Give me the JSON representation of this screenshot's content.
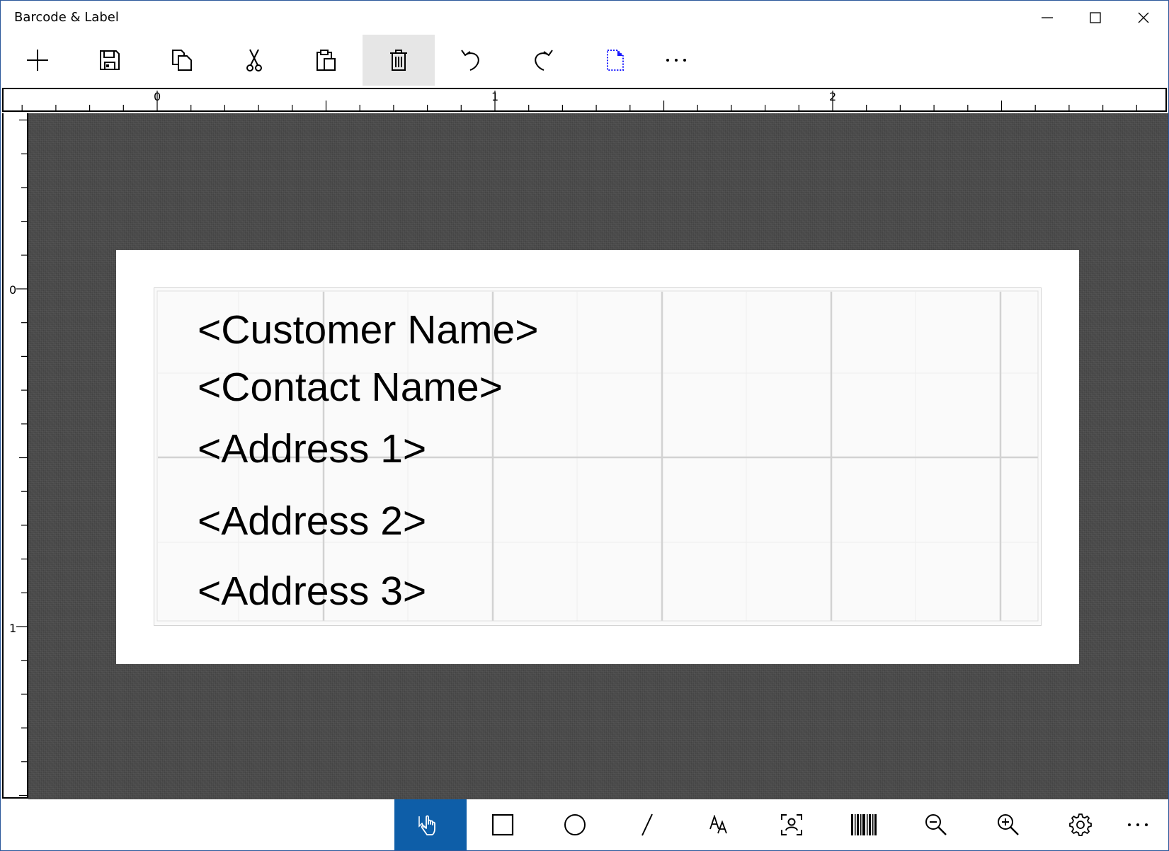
{
  "window": {
    "title": "Barcode & Label",
    "controls": [
      "minimize-icon",
      "maximize-icon",
      "close-icon"
    ]
  },
  "toolbar": {
    "items": [
      {
        "name": "new",
        "icon": "plus-icon"
      },
      {
        "name": "save",
        "icon": "save-icon"
      },
      {
        "name": "copy",
        "icon": "copy-icon"
      },
      {
        "name": "cut",
        "icon": "scissors-icon"
      },
      {
        "name": "paste",
        "icon": "paste-icon"
      },
      {
        "name": "delete",
        "icon": "trash-icon",
        "active": true
      },
      {
        "name": "undo",
        "icon": "undo-icon"
      },
      {
        "name": "redo",
        "icon": "redo-icon"
      },
      {
        "name": "page-setup",
        "icon": "page-setup-icon"
      },
      {
        "name": "more",
        "icon": "more-icon",
        "label": "..."
      }
    ]
  },
  "rulers": {
    "horizontal_labels": [
      "0",
      "1",
      "2"
    ],
    "vertical_labels": [
      "0",
      "1"
    ]
  },
  "label": {
    "fields": [
      "<Customer Name>",
      "<Contact Name>",
      "<Address 1>",
      "<Address 2>",
      "<Address 3>"
    ]
  },
  "bottom_toolbar": {
    "items": [
      {
        "name": "select",
        "icon": "hand-pointer-icon",
        "active": true
      },
      {
        "name": "rectangle",
        "icon": "rectangle-icon"
      },
      {
        "name": "ellipse",
        "icon": "circle-icon"
      },
      {
        "name": "line",
        "icon": "line-icon"
      },
      {
        "name": "text",
        "icon": "text-icon"
      },
      {
        "name": "image",
        "icon": "image-placeholder-icon"
      },
      {
        "name": "barcode",
        "icon": "barcode-icon"
      },
      {
        "name": "zoom-out",
        "icon": "zoom-out-icon"
      },
      {
        "name": "zoom-in",
        "icon": "zoom-in-icon"
      },
      {
        "name": "settings",
        "icon": "gear-icon"
      },
      {
        "name": "more",
        "icon": "more-icon",
        "label": "..."
      }
    ]
  },
  "colors": {
    "accent": "#0e5ea8",
    "page_setup_icon": "#1a1aff",
    "canvas": "#4a4a4a",
    "active_toolbar": "#e6e6e6"
  }
}
